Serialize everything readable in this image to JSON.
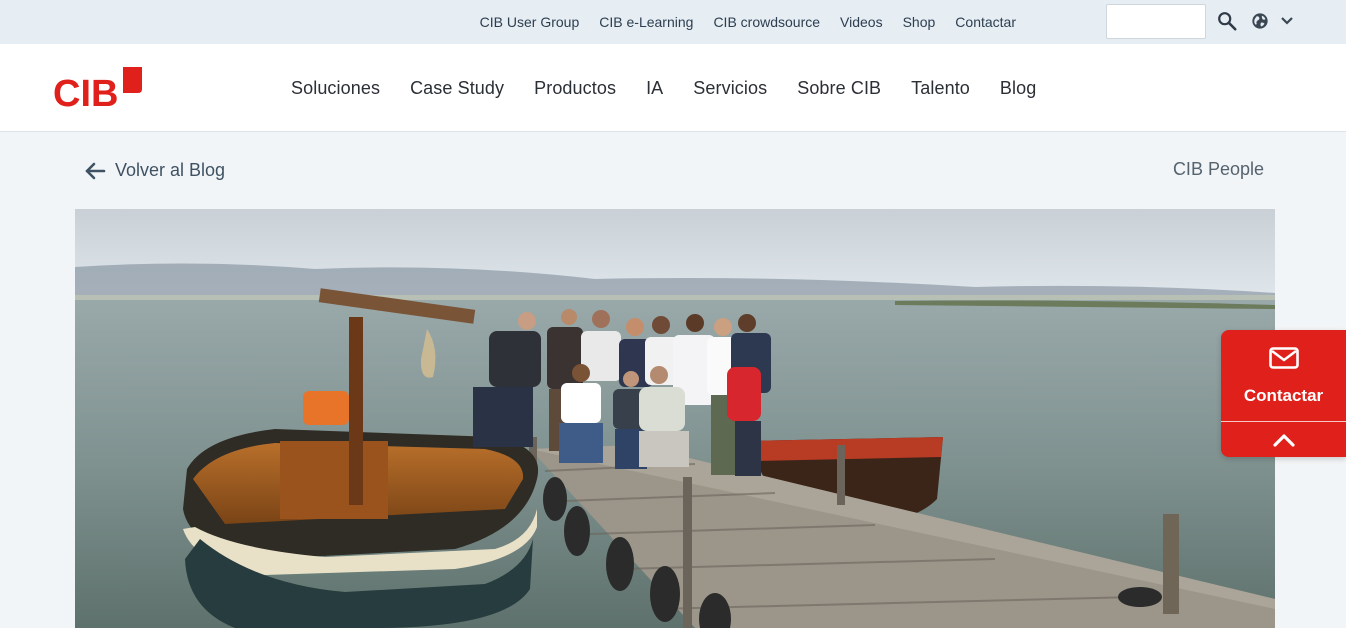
{
  "topbar": {
    "links": [
      "CIB User Group",
      "CIB e-Learning",
      "CIB crowdsource",
      "Videos",
      "Shop",
      "Contactar"
    ],
    "search_value": "",
    "search_icon": "search-icon",
    "language_icon": "globe-icon"
  },
  "header": {
    "logo_text": "CIB",
    "nav": [
      "Soluciones",
      "Case Study",
      "Productos",
      "IA",
      "Servicios",
      "Sobre CIB",
      "Talento",
      "Blog"
    ]
  },
  "content": {
    "back_label": "Volver al Blog",
    "category": "CIB People"
  },
  "contact_widget": {
    "label": "Contactar",
    "icon": "mail-icon",
    "scroll_icon": "chevron-up-icon"
  },
  "colors": {
    "brand_red": "#e0201a",
    "topbar_bg": "#e6edf3",
    "page_bg": "#f2f5f7"
  }
}
